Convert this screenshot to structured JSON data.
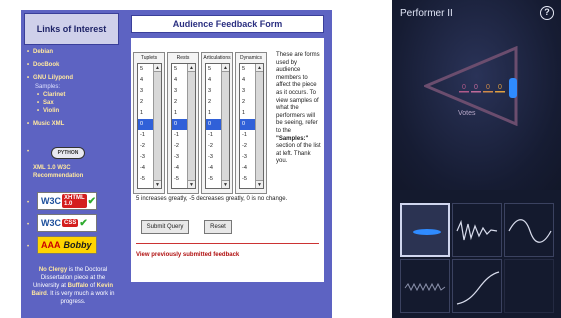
{
  "web": {
    "sidebar": {
      "title": "Links of Interest",
      "links": [
        "Debian",
        "DocBook",
        "GNU Lilypond"
      ],
      "samples_label": "Samples:",
      "samples": [
        "Clarinet",
        "Sax",
        "Violin"
      ],
      "links2": [
        "Music XML",
        "XML 1.0 W3C Recommendation"
      ],
      "python_badge": "PYTHON",
      "badges": [
        {
          "left": "W3C",
          "right": "XHTML 1.0"
        },
        {
          "left": "W3C",
          "right": "CSS"
        }
      ],
      "bobby": {
        "left": "AAA",
        "right": "Bobby"
      },
      "blurb_pre": "No Clergy",
      "blurb_mid": " is the Doctoral Dissertation piece at the University at ",
      "blurb_hl": "Buffalo",
      "blurb_mid2": " of ",
      "blurb_hl2": "Kevin Baird",
      "blurb_end": ". It is very much a work in progress."
    },
    "form": {
      "title": "Audience Feedback Form",
      "columns": [
        {
          "name": "Tuplets",
          "selected": "0"
        },
        {
          "name": "Rests",
          "selected": "0"
        },
        {
          "name": "Articulations",
          "selected": "0"
        },
        {
          "name": "Dynamics",
          "selected": "0"
        }
      ],
      "options": [
        "5",
        "4",
        "3",
        "2",
        "1",
        "0",
        "-1",
        "-2",
        "-3",
        "-4",
        "-5"
      ],
      "help_1": "These are forms used by audience members to affect the piece as it occurs. To view samples of what the performers will be seeing, refer to the ",
      "help_bold": "\"Samples:\"",
      "help_2": " section of the list at left. Thank you.",
      "scale_note": "5 increases greatly, -5 decreases greatly, 0 is no change.",
      "submit_label": "Submit Query",
      "reset_label": "Reset",
      "previous_link": "View previously submitted feedback"
    }
  },
  "app": {
    "title": "Performer II",
    "help_icon": "?",
    "votes_label": "Votes",
    "vote_counts": [
      "0",
      "0",
      "0",
      "0"
    ],
    "vote_colors": [
      "#b05a8a",
      "#c06a9a",
      "#d08a4a",
      "#e0a040"
    ],
    "accent": "#2f8bff",
    "tiles": [
      "flat-wave-icon",
      "noisy-wave-icon",
      "sine-wave-icon",
      "dense-wave-icon",
      "rising-wave-icon",
      "empty-tile"
    ],
    "active_tile": 0
  },
  "colors": {
    "sidebar": "#5d63c2",
    "link": "#ffe8a0",
    "app_bg": "#141a2e"
  }
}
